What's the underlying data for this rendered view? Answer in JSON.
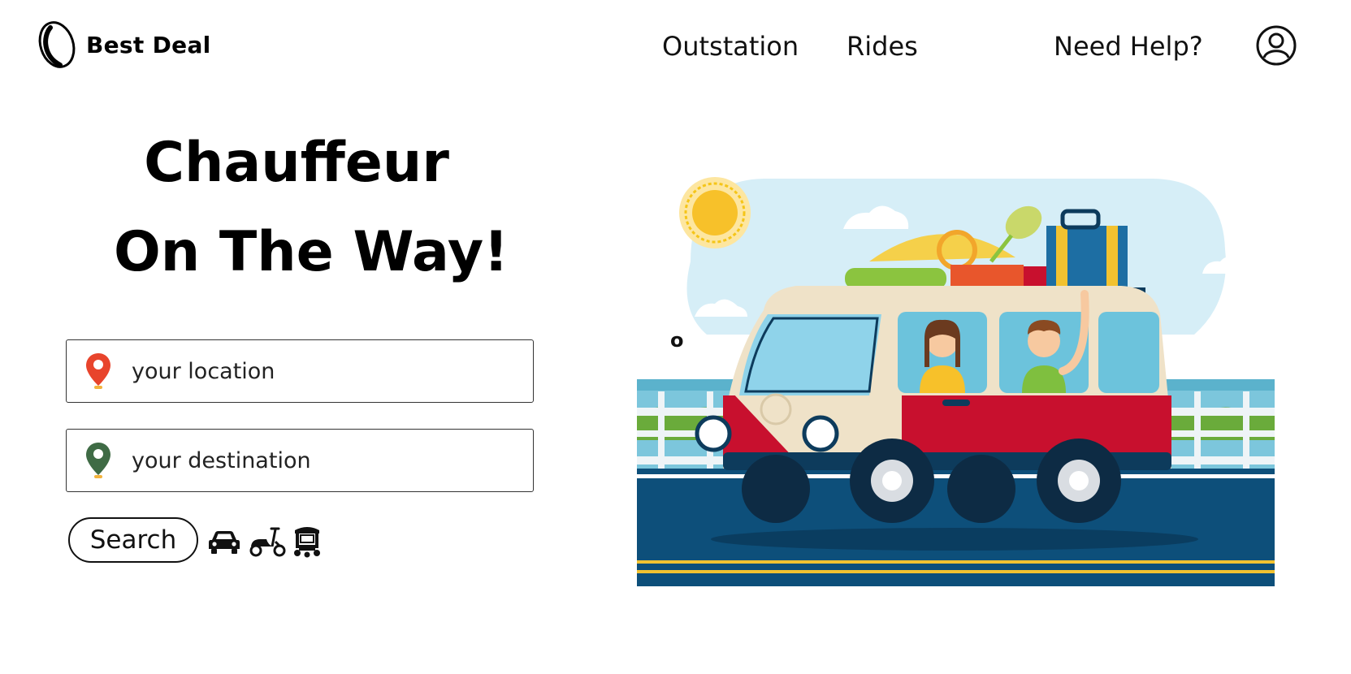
{
  "brand": {
    "name": "Best Deal"
  },
  "nav": {
    "outstation": "Outstation",
    "rides": "Rides",
    "help": "Need Help?"
  },
  "hero": {
    "line1": "Chauffeur",
    "line2": "On The Way!"
  },
  "search": {
    "location_placeholder": "your location",
    "destination_placeholder": "your destination",
    "button_label": "Search"
  },
  "modes": [
    "car-icon",
    "scooter-icon",
    "auto-rickshaw-icon"
  ],
  "stray_text": "o",
  "colors": {
    "location_pin": "#e8442c",
    "destination_pin": "#3f6b45",
    "van_red": "#c8102e",
    "sky": "#d6eef7",
    "road": "#0d4f7a"
  }
}
